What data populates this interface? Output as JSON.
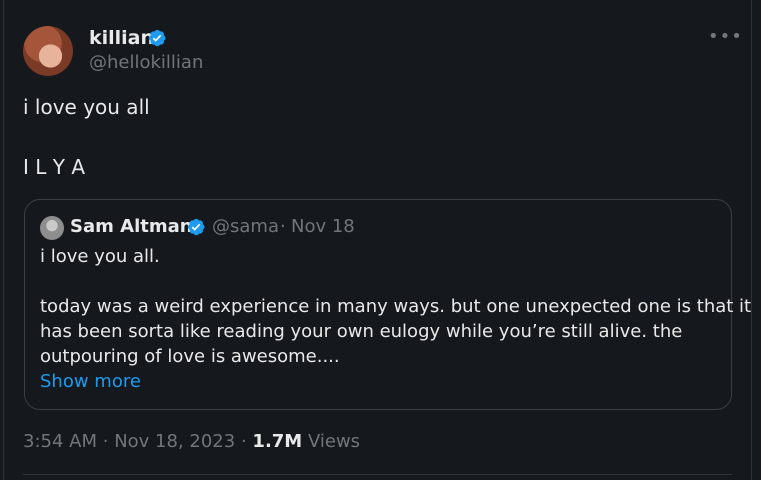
{
  "author": {
    "name": "killian",
    "handle": "@hellokillian",
    "verified": true
  },
  "menu": {
    "more_icon": "more-horizontal-icon",
    "more_glyph": "•••"
  },
  "tweet": {
    "line1": "i love you all",
    "line2": "I L Y A"
  },
  "quoted_tweet": {
    "author_name": "Sam Altman",
    "verified": true,
    "handle": "@sama",
    "separator": "·",
    "date": "Nov 18",
    "lines": [
      "i love you all.",
      "today was a weird experience in many ways. but one unexpected one is that it",
      "has been sorta like reading your own eulogy while you’re still alive. the",
      "outpouring of love is awesome...."
    ],
    "show_more": "Show more"
  },
  "footer": {
    "time": "3:54 AM",
    "sep1": "·",
    "date": "Nov 18, 2023",
    "sep2": "·",
    "views_count": "1.7M",
    "views_label": "Views"
  },
  "colors": {
    "background": "#15181c",
    "text": "#e7e9ea",
    "secondary": "#71767b",
    "accent": "#1d9bf0",
    "border": "#2f3336"
  }
}
